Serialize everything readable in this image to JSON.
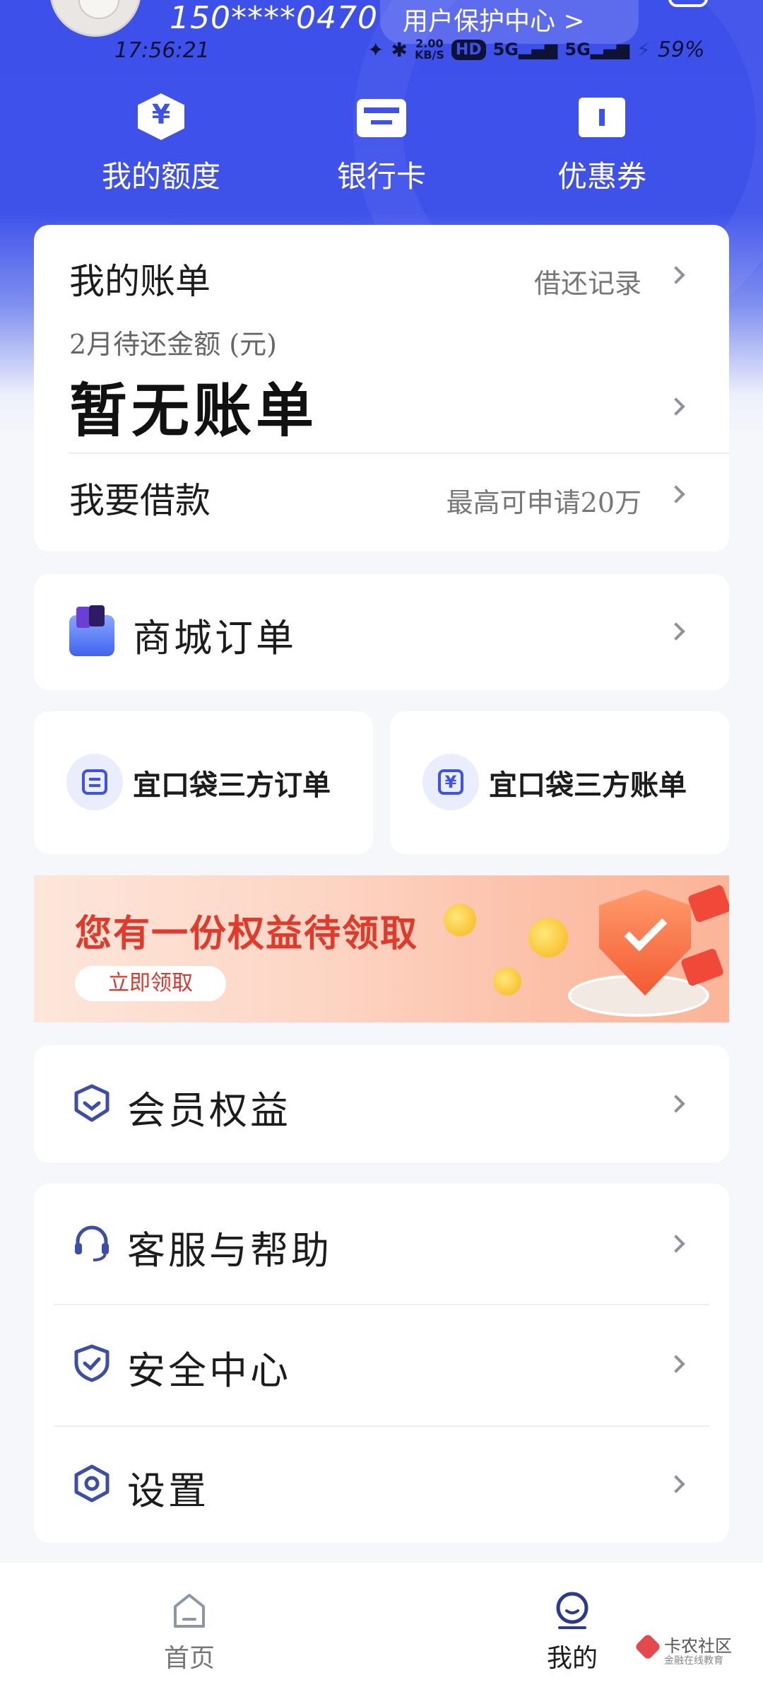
{
  "header": {
    "phone": "150****0470",
    "protect_center": "用户保护中心 >",
    "time": "17:56:21",
    "status": {
      "speed_value": "2.00",
      "speed_unit": "KB/S",
      "hd": "HD",
      "sim1": "5G",
      "sim2": "5G",
      "battery": "59%"
    }
  },
  "quick_actions": [
    {
      "label": "我的额度",
      "icon": "hexagon-yen-icon"
    },
    {
      "label": "银行卡",
      "icon": "bank-card-icon"
    },
    {
      "label": "优惠券",
      "icon": "ticket-icon"
    }
  ],
  "bill": {
    "title": "我的账单",
    "history_link": "借还记录",
    "due_label": "2月待还金额 (元)",
    "amount": "暂无账单",
    "loan_label": "我要借款",
    "loan_hint": "最高可申请20万"
  },
  "mall": {
    "label": "商城订单",
    "icon": "shopping-basket-icon"
  },
  "third_party": {
    "orders": "宜口袋三方订单",
    "bills": "宜口袋三方账单",
    "yen_symbol": "¥"
  },
  "banner": {
    "title": "您有一份权益待领取",
    "button": "立即领取"
  },
  "menu": [
    {
      "label": "会员权益",
      "icon": "vip-badge-icon"
    },
    {
      "label": "客服与帮助",
      "icon": "headset-icon"
    },
    {
      "label": "安全中心",
      "icon": "shield-check-icon"
    },
    {
      "label": "设置",
      "icon": "settings-icon"
    }
  ],
  "tabbar": {
    "home": "首页",
    "mine": "我的",
    "active": "mine"
  },
  "watermark": {
    "title": "卡农社区",
    "subtitle": "金融在线教育"
  },
  "colors": {
    "brand_blue": "#3e52ea",
    "icon_navy": "#3c4fa8",
    "banner_red": "#e23a2a"
  }
}
